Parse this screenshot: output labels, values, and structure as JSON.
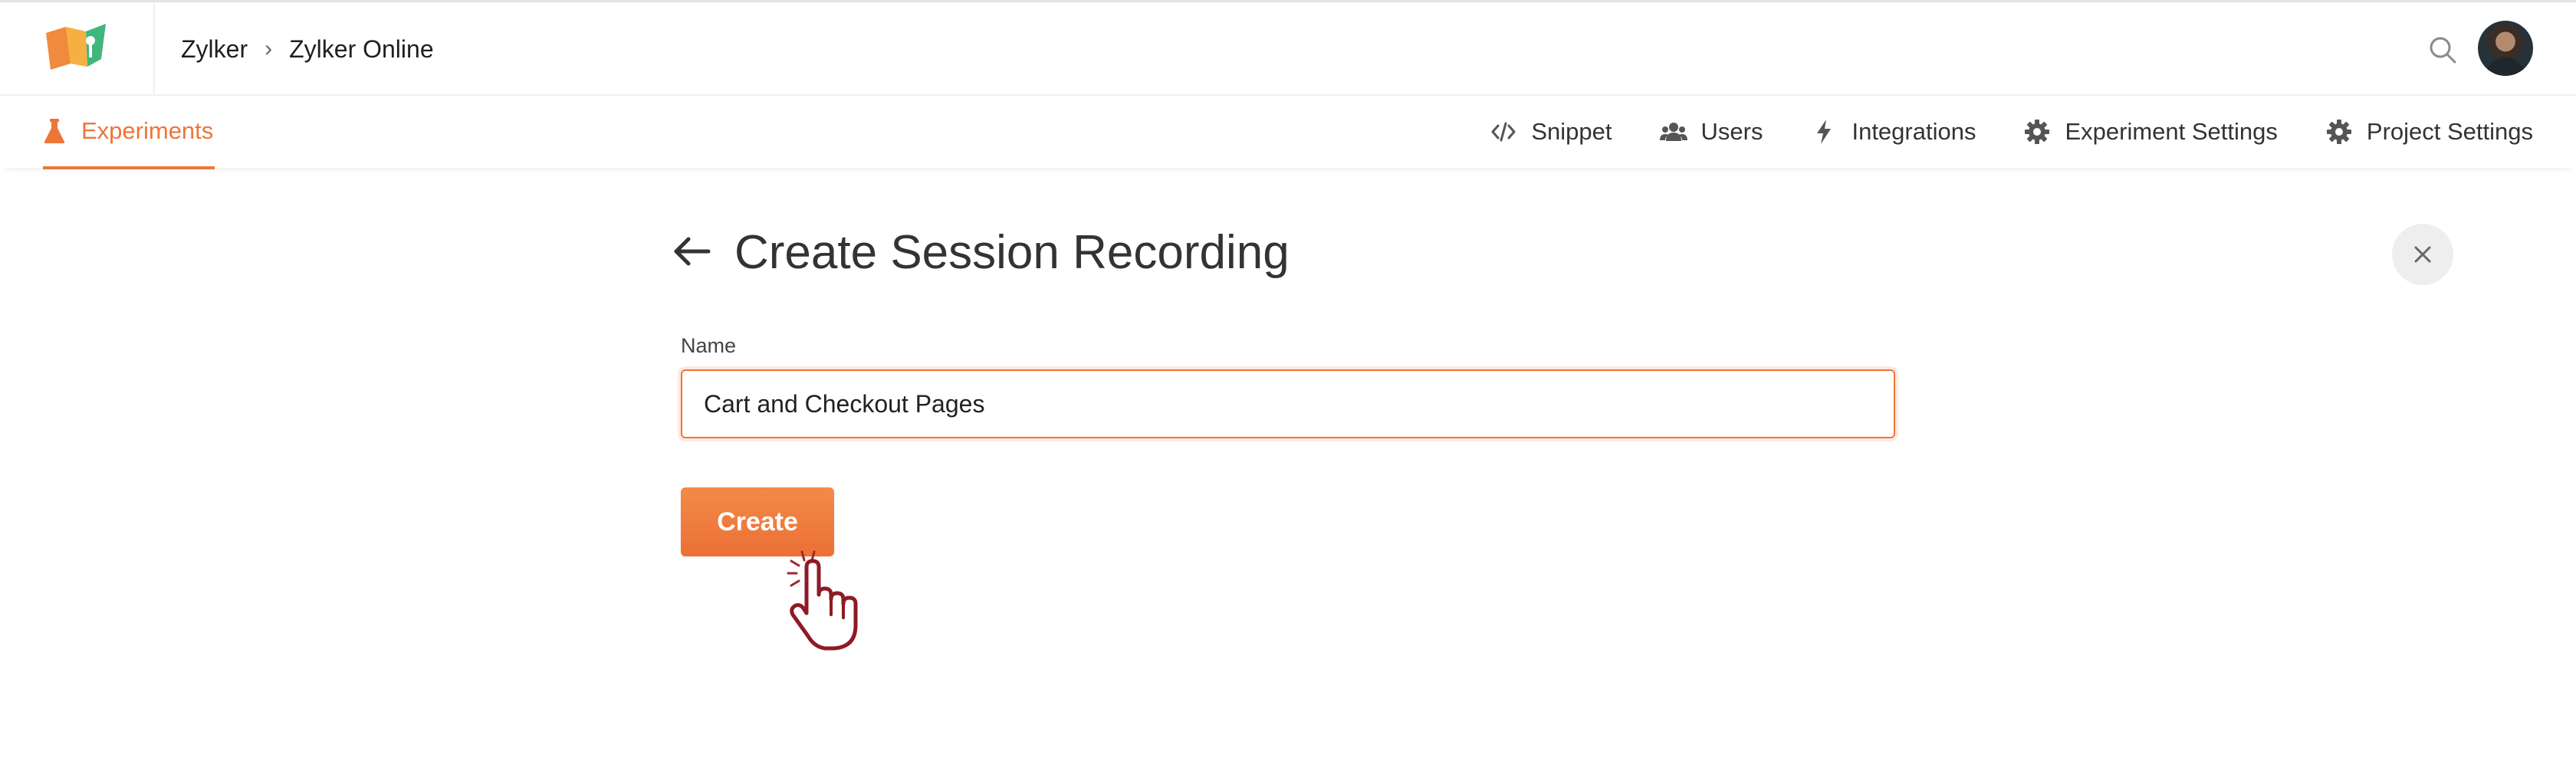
{
  "header": {
    "breadcrumb": {
      "org": "Zylker",
      "separator": "›",
      "project": "Zylker Online"
    },
    "icons": {
      "logo": "zylker-logo",
      "search": "search-icon",
      "avatar": "user-avatar"
    }
  },
  "subnav": {
    "active_tab": {
      "label": "Experiments",
      "icon": "flask-icon"
    },
    "items": [
      {
        "label": "Snippet",
        "icon": "code-icon"
      },
      {
        "label": "Users",
        "icon": "users-icon"
      },
      {
        "label": "Integrations",
        "icon": "bolt-icon"
      },
      {
        "label": "Experiment Settings",
        "icon": "gear-icon"
      },
      {
        "label": "Project Settings",
        "icon": "gear-icon"
      }
    ]
  },
  "main": {
    "title": "Create Session Recording",
    "form": {
      "name_label": "Name",
      "name_value": "Cart and Checkout Pages"
    },
    "create_label": "Create"
  },
  "colors": {
    "accent": "#ee7539",
    "text": "#333333"
  }
}
